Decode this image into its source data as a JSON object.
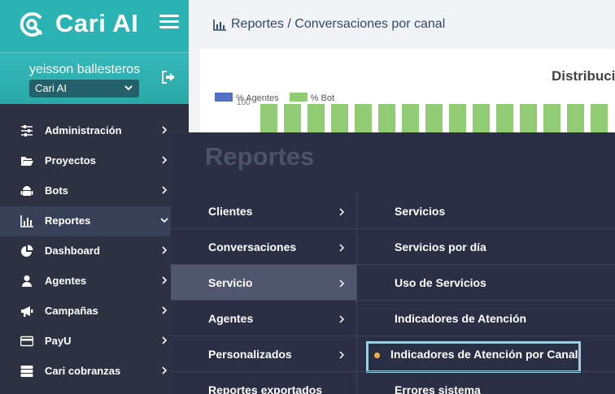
{
  "brand": {
    "name": "Cari AI"
  },
  "user": {
    "name": "yeisson ballesteros",
    "organization": "Cari AI"
  },
  "sidebar": {
    "items": [
      {
        "label": "Administración",
        "icon": "sliders-icon"
      },
      {
        "label": "Proyectos",
        "icon": "folder-open-icon"
      },
      {
        "label": "Bots",
        "icon": "android-icon"
      },
      {
        "label": "Reportes",
        "icon": "bar-chart-icon",
        "active": true
      },
      {
        "label": "Dashboard",
        "icon": "pie-chart-icon"
      },
      {
        "label": "Agentes",
        "icon": "user-icon"
      },
      {
        "label": "Campañas",
        "icon": "megaphone-icon"
      },
      {
        "label": "PayU",
        "icon": "credit-card-icon"
      },
      {
        "label": "Cari cobranzas",
        "icon": "server-icon"
      }
    ]
  },
  "header": {
    "breadcrumb": "Reportes / Conversaciones por canal"
  },
  "chart": {
    "title": "Distribuci",
    "legend": [
      {
        "label": "% Agentes",
        "color": "#5470c6"
      },
      {
        "label": "% Bot",
        "color": "#91cc75"
      }
    ],
    "y_tick_top": "100"
  },
  "chart_data": {
    "type": "bar",
    "series": [
      {
        "name": "% Agentes",
        "values": [
          0,
          0,
          0,
          0,
          0,
          0,
          0,
          0,
          0,
          0,
          0,
          0,
          0,
          0,
          0
        ]
      },
      {
        "name": "% Bot",
        "values": [
          100,
          100,
          100,
          100,
          100,
          100,
          100,
          100,
          100,
          100,
          100,
          100,
          100,
          100,
          100
        ]
      }
    ],
    "ylim": [
      0,
      100
    ],
    "legend": "top-left"
  },
  "mega_menu": {
    "title": "Reportes",
    "categories": [
      {
        "label": "Clientes"
      },
      {
        "label": "Conversaciones"
      },
      {
        "label": "Servicio",
        "active": true
      },
      {
        "label": "Agentes"
      },
      {
        "label": "Personalizados"
      },
      {
        "label": "Reportes exportados"
      }
    ],
    "subitems": [
      {
        "label": "Servicios"
      },
      {
        "label": "Servicios por día"
      },
      {
        "label": "Uso de Servicios"
      },
      {
        "label": "Indicadores de Atención"
      },
      {
        "label": "Indicadores de Atención por Canal",
        "active": true
      },
      {
        "label": "Errores sistema"
      }
    ],
    "highlight_color": "#9ccfe0",
    "bullet_color": "#f0ad4e"
  }
}
